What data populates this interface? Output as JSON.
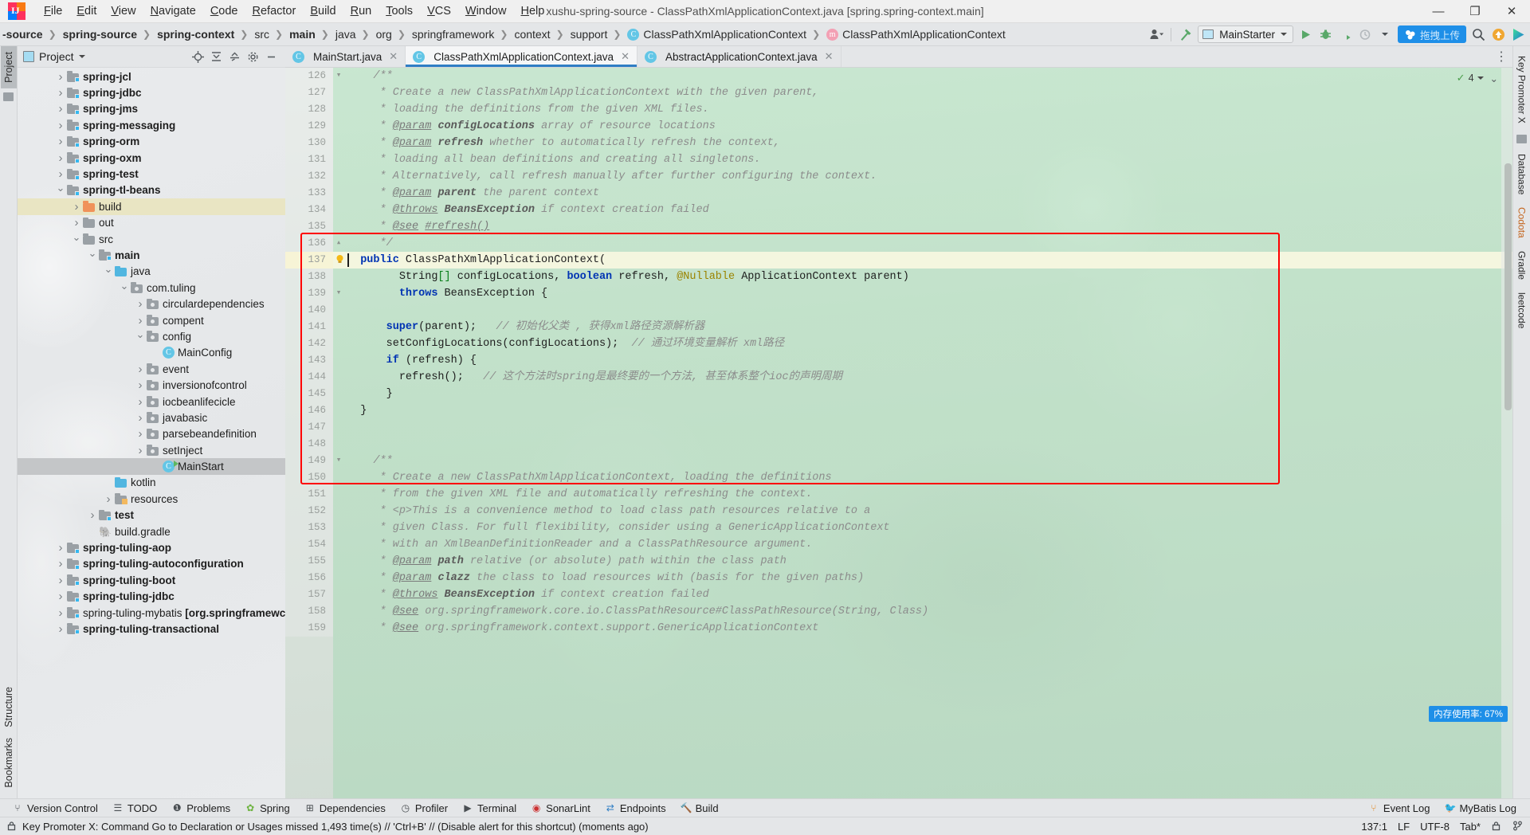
{
  "window": {
    "title": "xushu-spring-source - ClassPathXmlApplicationContext.java [spring.spring-context.main]",
    "controls": {
      "minimize": "—",
      "maximize": "❐",
      "close": "✕"
    }
  },
  "menubar": [
    "File",
    "Edit",
    "View",
    "Navigate",
    "Code",
    "Refactor",
    "Build",
    "Run",
    "Tools",
    "VCS",
    "Window",
    "Help"
  ],
  "breadcrumb": [
    {
      "label": "-source",
      "bold": true,
      "icon": ""
    },
    {
      "label": "spring-source",
      "bold": true,
      "icon": ""
    },
    {
      "label": "spring-context",
      "bold": true,
      "icon": ""
    },
    {
      "label": "src",
      "bold": false,
      "icon": ""
    },
    {
      "label": "main",
      "bold": true,
      "icon": ""
    },
    {
      "label": "java",
      "bold": false,
      "icon": ""
    },
    {
      "label": "org",
      "bold": false,
      "icon": ""
    },
    {
      "label": "springframework",
      "bold": false,
      "icon": ""
    },
    {
      "label": "context",
      "bold": false,
      "icon": ""
    },
    {
      "label": "support",
      "bold": false,
      "icon": ""
    },
    {
      "label": "ClassPathXmlApplicationContext",
      "bold": false,
      "icon": "class-icon",
      "badge": "C"
    },
    {
      "label": "ClassPathXmlApplicationContext",
      "bold": false,
      "icon": "method-icon",
      "badge": "m"
    }
  ],
  "toolbar": {
    "run_config": "MainStarter",
    "upload_chip": "拖拽上传",
    "icons": [
      "user-avatar-icon",
      "hammer-build-icon",
      "run-icon",
      "debug-icon",
      "coverage-icon",
      "profile-icon",
      "dropdown-icon",
      "search-icon",
      "update-icon",
      "play-gradient-icon"
    ]
  },
  "project_panel": {
    "title": "Project",
    "header_icons": [
      "locate-icon",
      "expand-all-icon",
      "collapse-all-icon",
      "settings-icon",
      "hide-icon"
    ],
    "tree": [
      {
        "label": "spring-jcl",
        "depth": 2,
        "arrow": "closed",
        "icon": "module-folder",
        "bold": true
      },
      {
        "label": "spring-jdbc",
        "depth": 2,
        "arrow": "closed",
        "icon": "module-folder",
        "bold": true
      },
      {
        "label": "spring-jms",
        "depth": 2,
        "arrow": "closed",
        "icon": "module-folder",
        "bold": true
      },
      {
        "label": "spring-messaging",
        "depth": 2,
        "arrow": "closed",
        "icon": "module-folder",
        "bold": true
      },
      {
        "label": "spring-orm",
        "depth": 2,
        "arrow": "closed",
        "icon": "module-folder",
        "bold": true
      },
      {
        "label": "spring-oxm",
        "depth": 2,
        "arrow": "closed",
        "icon": "module-folder",
        "bold": true
      },
      {
        "label": "spring-test",
        "depth": 2,
        "arrow": "closed",
        "icon": "module-folder",
        "bold": true
      },
      {
        "label": "spring-tl-beans",
        "depth": 2,
        "arrow": "open",
        "icon": "module-folder",
        "bold": true
      },
      {
        "label": "build",
        "depth": 3,
        "arrow": "closed",
        "icon": "build-folder",
        "bold": false,
        "state": "highlight"
      },
      {
        "label": "out",
        "depth": 3,
        "arrow": "closed",
        "icon": "plain-folder",
        "bold": false
      },
      {
        "label": "src",
        "depth": 3,
        "arrow": "open",
        "icon": "plain-folder",
        "bold": false
      },
      {
        "label": "main",
        "depth": 4,
        "arrow": "open",
        "icon": "module-folder",
        "bold": true
      },
      {
        "label": "java",
        "depth": 5,
        "arrow": "open",
        "icon": "source-folder",
        "bold": false
      },
      {
        "label": "com.tuling",
        "depth": 6,
        "arrow": "open",
        "icon": "package-folder",
        "bold": false
      },
      {
        "label": "circulardependencies",
        "depth": 7,
        "arrow": "closed",
        "icon": "package-folder",
        "bold": false
      },
      {
        "label": "compent",
        "depth": 7,
        "arrow": "closed",
        "icon": "package-folder",
        "bold": false
      },
      {
        "label": "config",
        "depth": 7,
        "arrow": "open",
        "icon": "package-folder",
        "bold": false
      },
      {
        "label": "MainConfig",
        "depth": 8,
        "arrow": "none",
        "icon": "class-icon",
        "bold": false
      },
      {
        "label": "event",
        "depth": 7,
        "arrow": "closed",
        "icon": "package-folder",
        "bold": false
      },
      {
        "label": "inversionofcontrol",
        "depth": 7,
        "arrow": "closed",
        "icon": "package-folder",
        "bold": false
      },
      {
        "label": "iocbeanlifecicle",
        "depth": 7,
        "arrow": "closed",
        "icon": "package-folder",
        "bold": false
      },
      {
        "label": "javabasic",
        "depth": 7,
        "arrow": "closed",
        "icon": "package-folder",
        "bold": false
      },
      {
        "label": "parsebeandefinition",
        "depth": 7,
        "arrow": "closed",
        "icon": "package-folder",
        "bold": false
      },
      {
        "label": "setInject",
        "depth": 7,
        "arrow": "closed",
        "icon": "package-folder",
        "bold": false
      },
      {
        "label": "MainStart",
        "depth": 8,
        "arrow": "none",
        "icon": "runnable-class-icon",
        "bold": false,
        "state": "selected"
      },
      {
        "label": "kotlin",
        "depth": 5,
        "arrow": "none",
        "icon": "source-folder",
        "bold": false
      },
      {
        "label": "resources",
        "depth": 5,
        "arrow": "closed",
        "icon": "resource-folder",
        "bold": false
      },
      {
        "label": "test",
        "depth": 4,
        "arrow": "closed",
        "icon": "module-folder",
        "bold": true
      },
      {
        "label": "build.gradle",
        "depth": 4,
        "arrow": "none",
        "icon": "gradle-icon",
        "bold": false
      },
      {
        "label": "spring-tuling-aop",
        "depth": 2,
        "arrow": "closed",
        "icon": "module-folder",
        "bold": true
      },
      {
        "label": "spring-tuling-autoconfiguration",
        "depth": 2,
        "arrow": "closed",
        "icon": "module-folder",
        "bold": true
      },
      {
        "label": "spring-tuling-boot",
        "depth": 2,
        "arrow": "closed",
        "icon": "module-folder",
        "bold": true
      },
      {
        "label": "spring-tuling-jdbc",
        "depth": 2,
        "arrow": "closed",
        "icon": "module-folder",
        "bold": true
      },
      {
        "label": "spring-tuling-mybatis [org.springframewc",
        "depth": 2,
        "arrow": "closed",
        "icon": "module-folder",
        "bold": false
      },
      {
        "label": "spring-tuling-transactional",
        "depth": 2,
        "arrow": "closed",
        "icon": "module-folder",
        "bold": true
      }
    ]
  },
  "left_strip": {
    "tabs": [
      "Project"
    ],
    "bottom_tabs": [
      "Structure",
      "Bookmarks"
    ]
  },
  "right_strip": {
    "tabs": [
      "Key Promoter X",
      "Database",
      "Codota",
      "Gradle",
      "leetcode"
    ]
  },
  "editor": {
    "tabs": [
      {
        "label": "MainStart.java",
        "active": false,
        "badge": "C"
      },
      {
        "label": "ClassPathXmlApplicationContext.java",
        "active": true,
        "badge": "C"
      },
      {
        "label": "AbstractApplicationContext.java",
        "active": false,
        "badge": "C"
      }
    ],
    "inspection": {
      "count": "4",
      "check": "✓"
    },
    "memory_chip": "内存使用率: 67%",
    "lines": [
      {
        "n": "126",
        "fold": "▾",
        "html": "<span class='indent'>    </span><span class='cmt'>/**</span>"
      },
      {
        "n": "127",
        "fold": "",
        "html": "<span class='indent'>     </span><span class='cmt'>* Create a new ClassPathXmlApplicationContext with the given parent,</span>"
      },
      {
        "n": "128",
        "fold": "",
        "html": "<span class='indent'>     </span><span class='cmt'>* loading the definitions from the given XML files.</span>"
      },
      {
        "n": "129",
        "fold": "",
        "html": "<span class='indent'>     </span><span class='cmt'>* <span class='tag'>@param</span> <span class='bld'>configLocations</span> array of resource locations</span>"
      },
      {
        "n": "130",
        "fold": "",
        "html": "<span class='indent'>     </span><span class='cmt'>* <span class='tag'>@param</span> <span class='bld'>refresh</span> whether to automatically refresh the context,</span>"
      },
      {
        "n": "131",
        "fold": "",
        "html": "<span class='indent'>     </span><span class='cmt'>* loading all bean definitions and creating all singletons.</span>"
      },
      {
        "n": "132",
        "fold": "",
        "html": "<span class='indent'>     </span><span class='cmt'>* Alternatively, call refresh manually after further configuring the context.</span>"
      },
      {
        "n": "133",
        "fold": "",
        "html": "<span class='indent'>     </span><span class='cmt'>* <span class='tag'>@param</span> <span class='bld'>parent</span> the parent context</span>"
      },
      {
        "n": "134",
        "fold": "",
        "html": "<span class='indent'>     </span><span class='cmt'>* <span class='tag'>@throws</span> <span class='bld'>BeansException</span> if context creation failed</span>"
      },
      {
        "n": "135",
        "fold": "",
        "html": "<span class='indent'>     </span><span class='cmt'>* <span class='tag'>@see</span> <span class='tag'>#refresh()</span></span>"
      },
      {
        "n": "136",
        "fold": "▴",
        "html": "<span class='indent'>     </span><span class='cmt'>*/</span>"
      },
      {
        "n": "137",
        "fold": "",
        "current": true,
        "bulb": true,
        "caret": true,
        "html": "<span class='indent'>  </span><span class='k'>public</span> <span class='plain'>ClassPathXmlApplicationContext(</span>"
      },
      {
        "n": "138",
        "fold": "",
        "html": "<span class='indent'>        </span><span class='plain'>String</span><span class='str'>[]</span><span class='plain'> configLocations, </span><span class='k'>boolean</span><span class='plain'> refresh, </span><span class='ann'>@Nullable</span><span class='plain'> ApplicationContext parent)</span>"
      },
      {
        "n": "139",
        "fold": "▾",
        "html": "<span class='indent'>        </span><span class='k'>throws</span><span class='plain'> BeansException {</span>"
      },
      {
        "n": "140",
        "fold": "",
        "html": ""
      },
      {
        "n": "141",
        "fold": "",
        "html": "<span class='indent'>      </span><span class='k'>super</span><span class='plain'>(parent);</span>   <span class='cmt'>// 初始化父类 , 获得xml路径资源解析器</span>"
      },
      {
        "n": "142",
        "fold": "",
        "html": "<span class='indent'>      </span><span class='plain'>setConfigLocations(configLocations);</span>  <span class='cmt'>// 通过环境变量解析 xml路径</span>"
      },
      {
        "n": "143",
        "fold": "",
        "html": "<span class='indent'>      </span><span class='k'>if</span><span class='plain'> (refresh) {</span>"
      },
      {
        "n": "144",
        "fold": "",
        "html": "<span class='indent'>        </span><span class='plain'>refresh();</span>   <span class='cmt'>// 这个方法时spring是最终要的一个方法, 甚至体系整个ioc的声明周期</span>"
      },
      {
        "n": "145",
        "fold": "",
        "html": "<span class='indent'>      </span><span class='plain'>}</span>"
      },
      {
        "n": "146",
        "fold": "",
        "html": "<span class='indent'>  </span><span class='plain'>}</span>"
      },
      {
        "n": "147",
        "fold": "",
        "html": ""
      },
      {
        "n": "148",
        "fold": "",
        "html": ""
      },
      {
        "n": "149",
        "fold": "▾",
        "html": "<span class='indent'>    </span><span class='cmt'>/**</span>"
      },
      {
        "n": "150",
        "fold": "",
        "html": "<span class='indent'>     </span><span class='cmt'>* Create a new ClassPathXmlApplicationContext, loading the definitions</span>"
      },
      {
        "n": "151",
        "fold": "",
        "html": "<span class='indent'>     </span><span class='cmt'>* from the given XML file and automatically refreshing the context.</span>"
      },
      {
        "n": "152",
        "fold": "",
        "html": "<span class='indent'>     </span><span class='cmt'>* &lt;p&gt;This is a convenience method to load class path resources relative to a</span>"
      },
      {
        "n": "153",
        "fold": "",
        "html": "<span class='indent'>     </span><span class='cmt'>* given Class. For full flexibility, consider using a GenericApplicationContext</span>"
      },
      {
        "n": "154",
        "fold": "",
        "html": "<span class='indent'>     </span><span class='cmt'>* with an XmlBeanDefinitionReader and a ClassPathResource argument.</span>"
      },
      {
        "n": "155",
        "fold": "",
        "html": "<span class='indent'>     </span><span class='cmt'>* <span class='tag'>@param</span> <span class='bld'>path</span> relative (or absolute) path within the class path</span>"
      },
      {
        "n": "156",
        "fold": "",
        "html": "<span class='indent'>     </span><span class='cmt'>* <span class='tag'>@param</span> <span class='bld'>clazz</span> the class to load resources with (basis for the given paths)</span>"
      },
      {
        "n": "157",
        "fold": "",
        "html": "<span class='indent'>     </span><span class='cmt'>* <span class='tag'>@throws</span> <span class='bld'>BeansException</span> if context creation failed</span>"
      },
      {
        "n": "158",
        "fold": "",
        "html": "<span class='indent'>     </span><span class='cmt'>* <span class='tag'>@see</span> org.springframework.core.io.ClassPathResource#ClassPathResource(String, Class)</span>"
      },
      {
        "n": "159",
        "fold": "",
        "html": "<span class='indent'>     </span><span class='cmt'>* <span class='tag'>@see</span> org.springframework.context.support.GenericApplicationContext</span>"
      }
    ]
  },
  "toolwindow_bar": {
    "left": [
      {
        "label": "Version Control",
        "icon": "branch-icon"
      },
      {
        "label": "TODO",
        "icon": "list-icon"
      },
      {
        "label": "Problems",
        "icon": "warning-icon"
      },
      {
        "label": "Spring",
        "icon": "spring-leaf-icon"
      },
      {
        "label": "Dependencies",
        "icon": "dependencies-icon"
      },
      {
        "label": "Profiler",
        "icon": "profiler-icon"
      },
      {
        "label": "Terminal",
        "icon": "terminal-icon"
      },
      {
        "label": "SonarLint",
        "icon": "sonarlint-icon"
      },
      {
        "label": "Endpoints",
        "icon": "endpoints-icon"
      },
      {
        "label": "Build",
        "icon": "hammer-icon"
      }
    ],
    "right": [
      {
        "label": "Event Log",
        "icon": "event-log-icon"
      },
      {
        "label": "MyBatis Log",
        "icon": "mybatis-icon"
      }
    ]
  },
  "statusbar": {
    "message": "Key Promoter X: Command Go to Declaration or Usages missed 1,493 time(s) // 'Ctrl+B' // (Disable alert for this shortcut) (moments ago)",
    "position": "137:1",
    "line_sep": "LF",
    "encoding": "UTF-8",
    "indent": "Tab*",
    "lock_icon": "lock-icon",
    "branch_icon": "branch-icon"
  }
}
